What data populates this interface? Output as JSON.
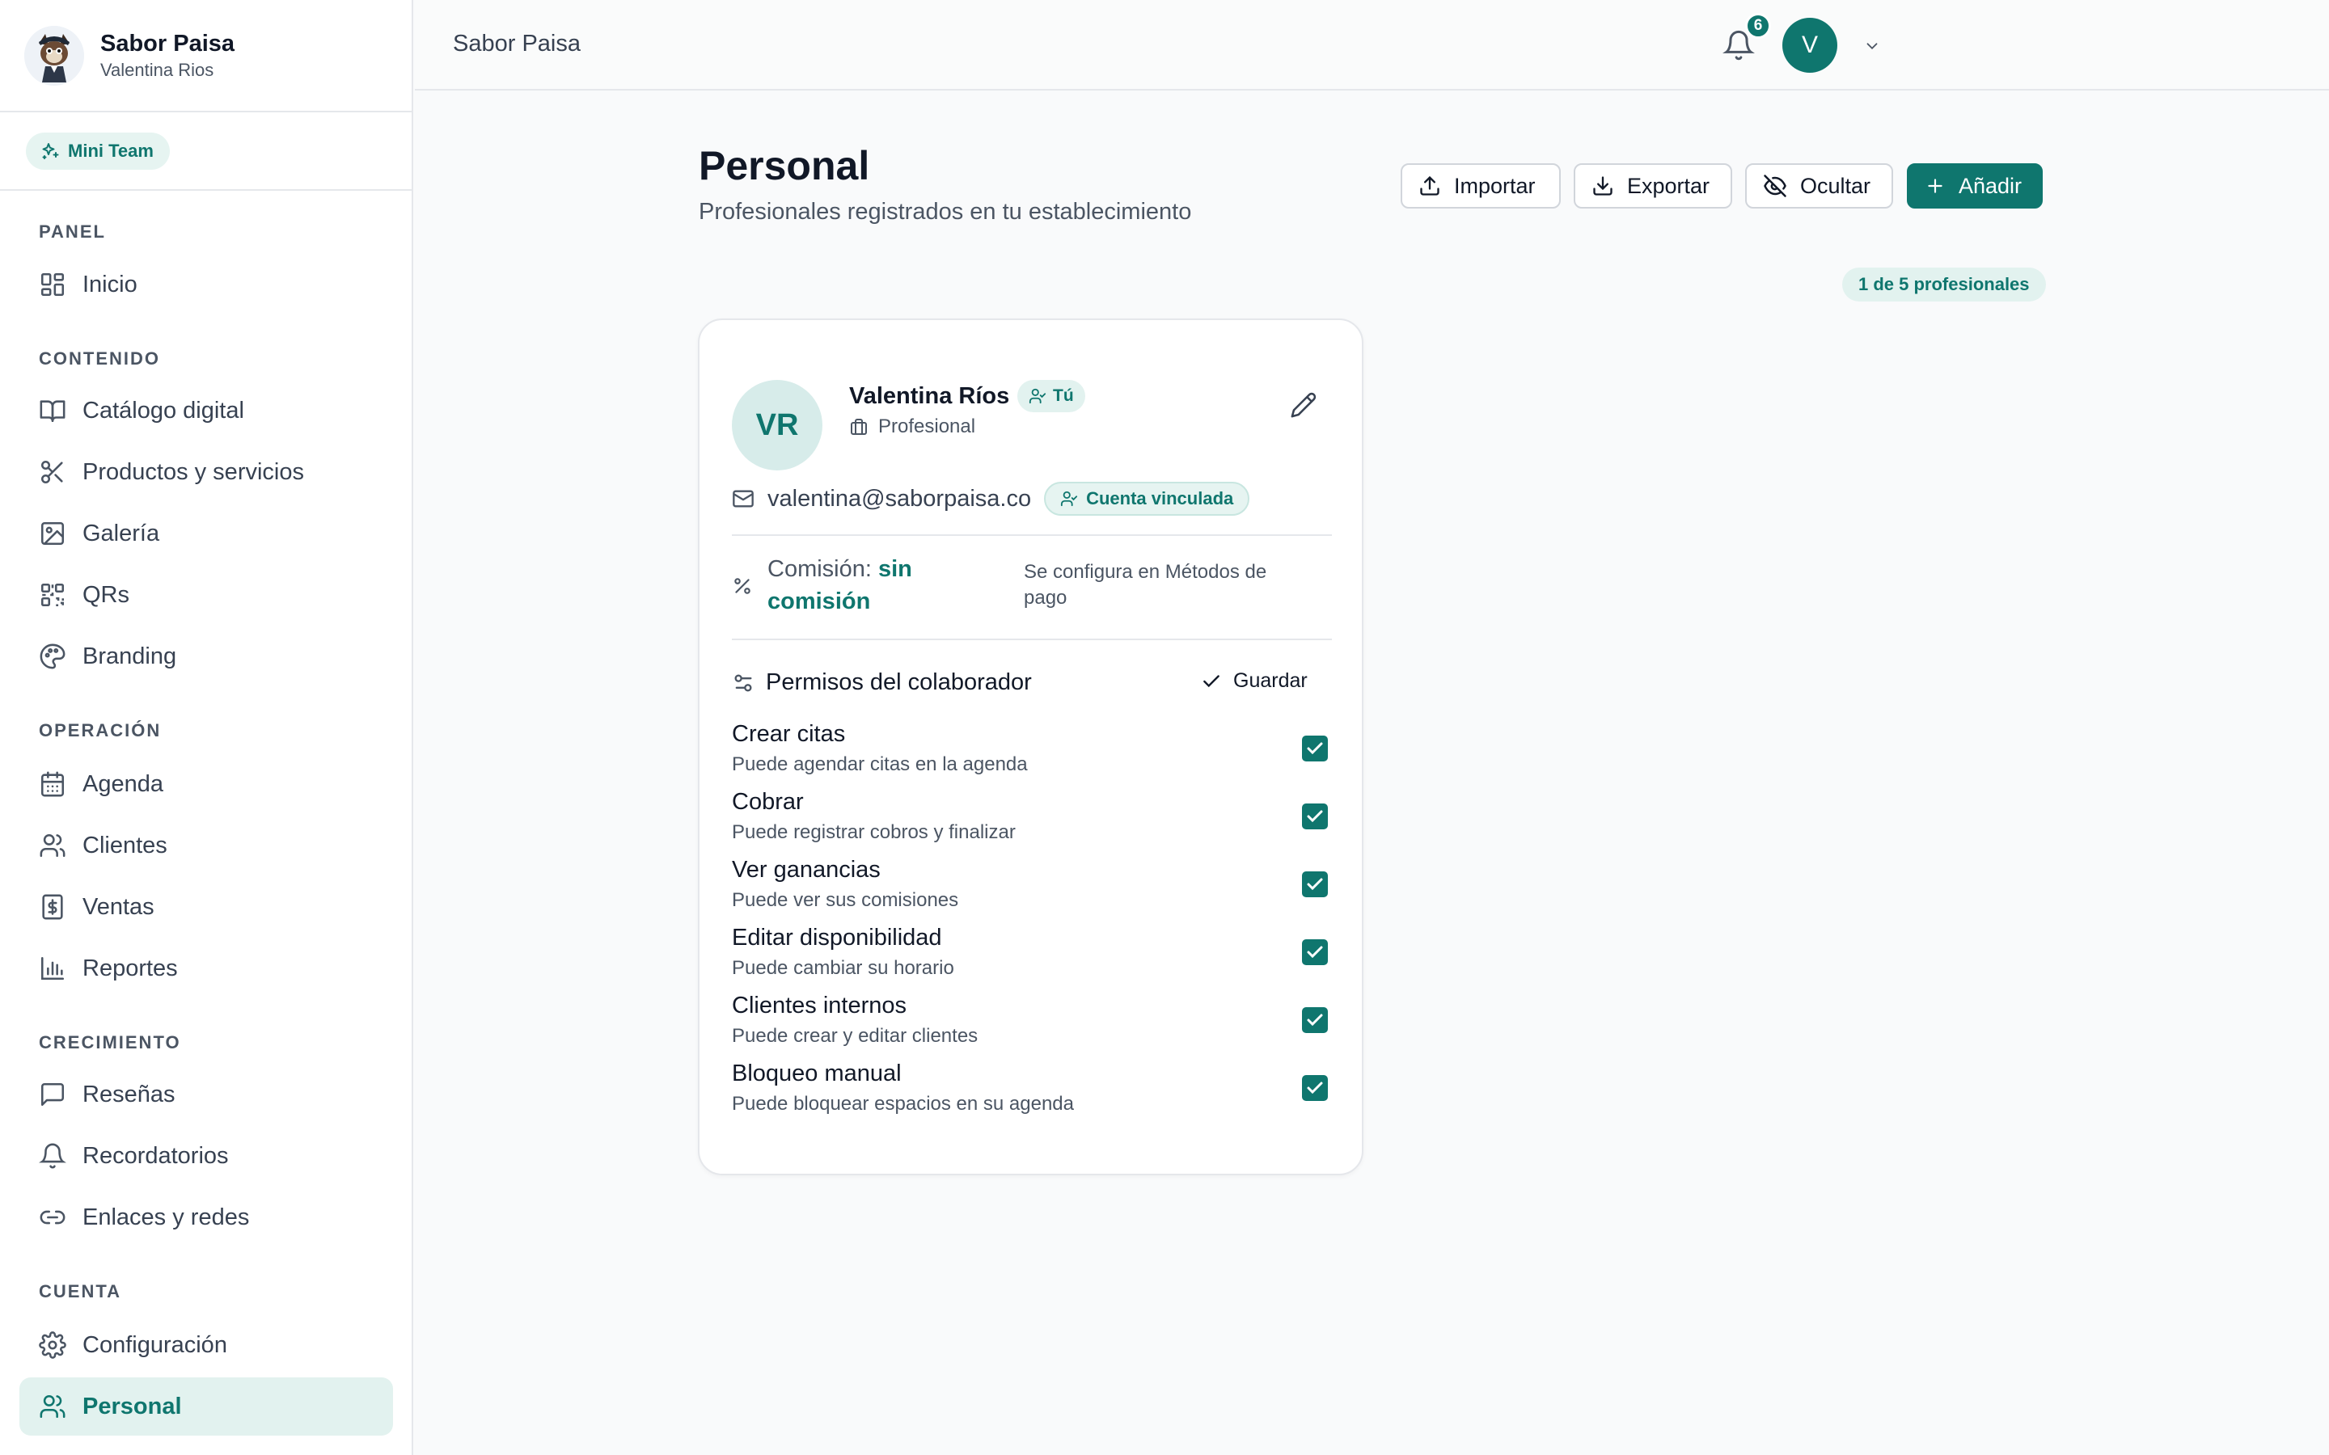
{
  "brand": {
    "name": "Sabor Paisa",
    "user": "Valentina Rios",
    "plan": "Mini Team"
  },
  "nav": {
    "sections": [
      {
        "title": "PANEL",
        "items": [
          {
            "label": "Inicio",
            "icon": "dashboard-icon"
          }
        ]
      },
      {
        "title": "CONTENIDO",
        "items": [
          {
            "label": "Catálogo digital",
            "icon": "book-icon"
          },
          {
            "label": "Productos y servicios",
            "icon": "scissors-icon"
          },
          {
            "label": "Galería",
            "icon": "image-icon"
          },
          {
            "label": "QRs",
            "icon": "qr-icon"
          },
          {
            "label": "Branding",
            "icon": "palette-icon"
          }
        ]
      },
      {
        "title": "OPERACIÓN",
        "items": [
          {
            "label": "Agenda",
            "icon": "calendar-icon"
          },
          {
            "label": "Clientes",
            "icon": "users-icon"
          },
          {
            "label": "Ventas",
            "icon": "dollar-icon"
          },
          {
            "label": "Reportes",
            "icon": "bar-chart-icon"
          }
        ]
      },
      {
        "title": "CRECIMIENTO",
        "items": [
          {
            "label": "Reseñas",
            "icon": "message-icon"
          },
          {
            "label": "Recordatorios",
            "icon": "bell-icon"
          },
          {
            "label": "Enlaces y redes",
            "icon": "link-icon"
          }
        ]
      },
      {
        "title": "CUENTA",
        "items": [
          {
            "label": "Configuración",
            "icon": "gear-icon"
          },
          {
            "label": "Personal",
            "icon": "users-icon",
            "active": true
          }
        ]
      }
    ]
  },
  "topbar": {
    "title": "Sabor Paisa",
    "notifications": "6",
    "avatar": "V"
  },
  "page": {
    "title": "Personal",
    "subtitle": "Profesionales registrados en tu establecimiento",
    "count": "1 de 5 profesionales",
    "buttons": {
      "import": "Importar",
      "export": "Exportar",
      "hide": "Ocultar",
      "add": "Añadir"
    }
  },
  "card": {
    "initials": "VR",
    "name": "Valentina Ríos",
    "you_badge": "Tú",
    "role": "Profesional",
    "email": "valentina@saborpaisa.co",
    "linked_badge": "Cuenta vinculada",
    "commission_label": "Comisión:",
    "commission_value": "sin comisión",
    "commission_note": "Se configura en Métodos de pago",
    "permissions_title": "Permisos del colaborador",
    "save_label": "Guardar",
    "permissions": [
      {
        "label": "Crear citas",
        "desc": "Puede agendar citas en la agenda",
        "checked": true
      },
      {
        "label": "Cobrar",
        "desc": "Puede registrar cobros y finalizar",
        "checked": true
      },
      {
        "label": "Ver ganancias",
        "desc": "Puede ver sus comisiones",
        "checked": true
      },
      {
        "label": "Editar disponibilidad",
        "desc": "Puede cambiar su horario",
        "checked": true
      },
      {
        "label": "Clientes internos",
        "desc": "Puede crear y editar clientes",
        "checked": true
      },
      {
        "label": "Bloqueo manual",
        "desc": "Puede bloquear espacios en su agenda",
        "checked": true
      }
    ]
  },
  "colors": {
    "accent": "#0f766e",
    "accent_light": "#e2f2ef"
  }
}
